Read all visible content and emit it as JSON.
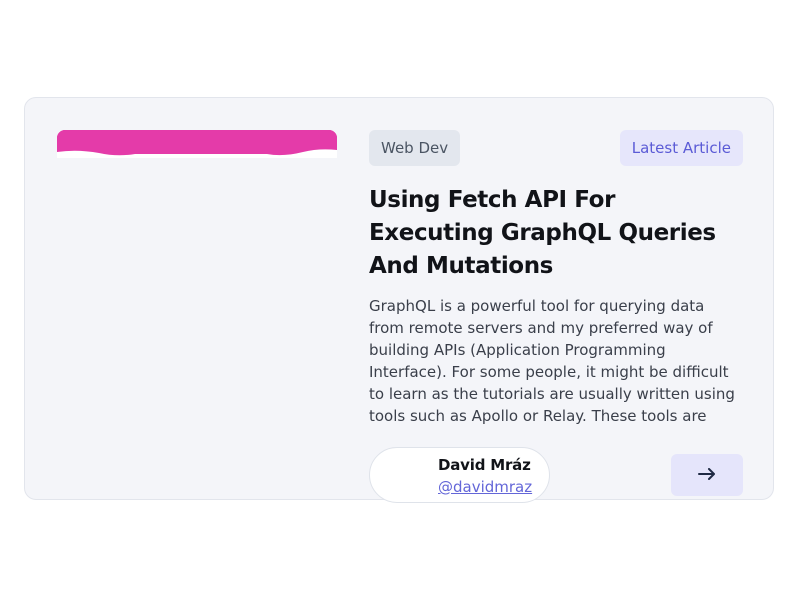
{
  "article_card": {
    "category_tag": "Web Dev",
    "status_badge": "Latest Article",
    "title": "Using Fetch API For Executing GraphQL Queries And Mutations",
    "excerpt": "GraphQL is a powerful tool for querying data from remote servers and my preferred way of building APIs (Application Programming Interface). For some people, it might be difficult to learn as the tutorials are usually written using tools such as Apollo or Relay. These tools are great but often…",
    "author": {
      "name": "David Mráz",
      "handle": "@davidmraz"
    },
    "read_more_icon": "arrow-right-icon",
    "thumbnail_color": "#e43ba9",
    "accent_color": "#6366d8"
  }
}
